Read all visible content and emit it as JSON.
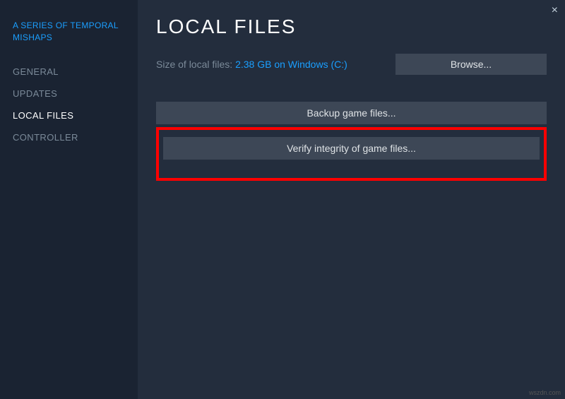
{
  "close_label": "×",
  "sidebar": {
    "game_title": "A SERIES OF TEMPORAL MISHAPS",
    "items": [
      {
        "label": "GENERAL"
      },
      {
        "label": "UPDATES"
      },
      {
        "label": "LOCAL FILES"
      },
      {
        "label": "CONTROLLER"
      }
    ]
  },
  "main": {
    "title": "LOCAL FILES",
    "size_label": "Size of local files: ",
    "size_value": "2.38 GB on Windows (C:)",
    "browse_label": "Browse...",
    "backup_label": "Backup game files...",
    "verify_label": "Verify integrity of game files..."
  },
  "watermark": "wszdn.com"
}
